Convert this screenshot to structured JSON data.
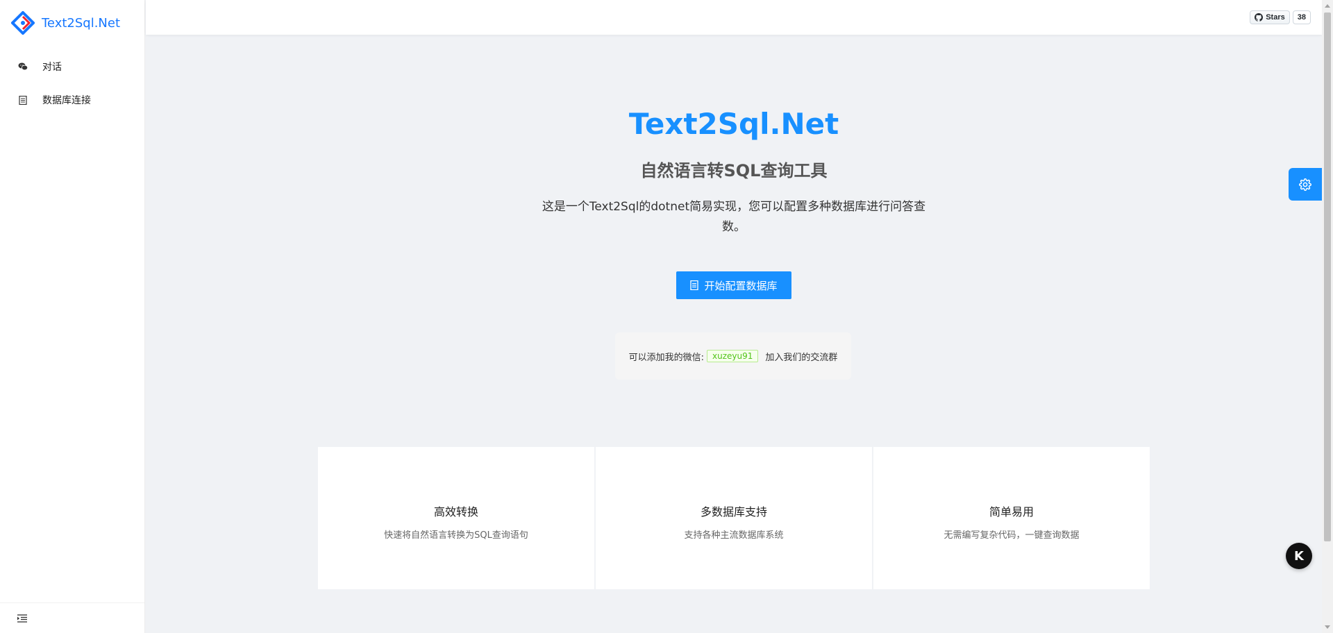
{
  "brand": {
    "name": "Text2Sql.Net",
    "accent": "#1890ff"
  },
  "sidebar": {
    "items": [
      {
        "label": "对话",
        "icon": "wechat-icon"
      },
      {
        "label": "数据库连接",
        "icon": "database-icon"
      }
    ],
    "footer_icon": "menu-fold-icon"
  },
  "header": {
    "github": {
      "label": "Stars",
      "count": "38",
      "icon": "github-icon"
    }
  },
  "hero": {
    "title": "Text2Sql.Net",
    "subtitle": "自然语言转SQL查询工具",
    "description": "这是一个Text2Sql的dotnet简易实现，您可以配置多种数据库进行问答查数。",
    "cta_label": "开始配置数据库",
    "cta_icon": "database-icon"
  },
  "wechat": {
    "prefix": "可以添加我的微信:",
    "tag": "xuzeyu91",
    "suffix": "加入我们的交流群"
  },
  "features": [
    {
      "title": "高效转换",
      "desc": "快速将自然语言转换为SQL查询语句"
    },
    {
      "title": "多数据库支持",
      "desc": "支持各种主流数据库系统"
    },
    {
      "title": "简单易用",
      "desc": "无需编写复杂代码，一键查询数据"
    }
  ],
  "floating": {
    "settings_icon": "gear-icon",
    "chat_label": "K"
  }
}
